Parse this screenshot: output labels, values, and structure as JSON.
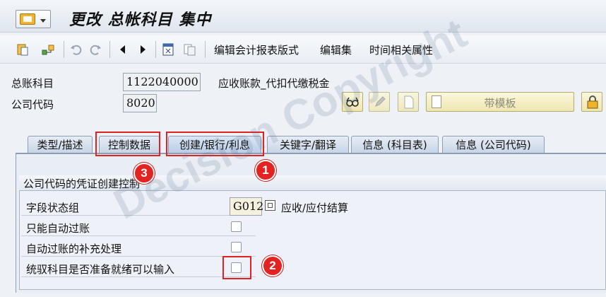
{
  "window": {
    "title": "更改 总帐科目 集中"
  },
  "toolbar": {
    "items": [
      "编辑会计报表版式",
      "编辑集",
      "时间相关属性"
    ]
  },
  "header": {
    "gl_account_label": "总账科目",
    "gl_account_value": "1122040000",
    "gl_account_desc": "应收账款_代扣代缴税金",
    "company_code_label": "公司代码",
    "company_code_value": "8020",
    "template_button": "带模板"
  },
  "tabs": [
    {
      "label": "类型/描述"
    },
    {
      "label": "控制数据"
    },
    {
      "label": "创建/银行/利息"
    },
    {
      "label": "关键字/翻译"
    },
    {
      "label": "信息 (科目表)"
    },
    {
      "label": "信息 (公司代码)"
    }
  ],
  "group": {
    "title": "公司代码的凭证创建控制",
    "field_status_label": "字段状态组",
    "field_status_value": "G012",
    "field_status_desc": "应收/应付结算",
    "checkboxes": [
      {
        "label": "只能自动过账",
        "checked": false
      },
      {
        "label": "自动过账的补充处理",
        "checked": false
      },
      {
        "label": "统驭科目是否准备就绪可以输入",
        "checked": false
      }
    ]
  },
  "annotations": {
    "badge1": "1",
    "badge2": "2",
    "badge3": "3",
    "color": "#e02222"
  },
  "watermark": "Decision Copyright"
}
